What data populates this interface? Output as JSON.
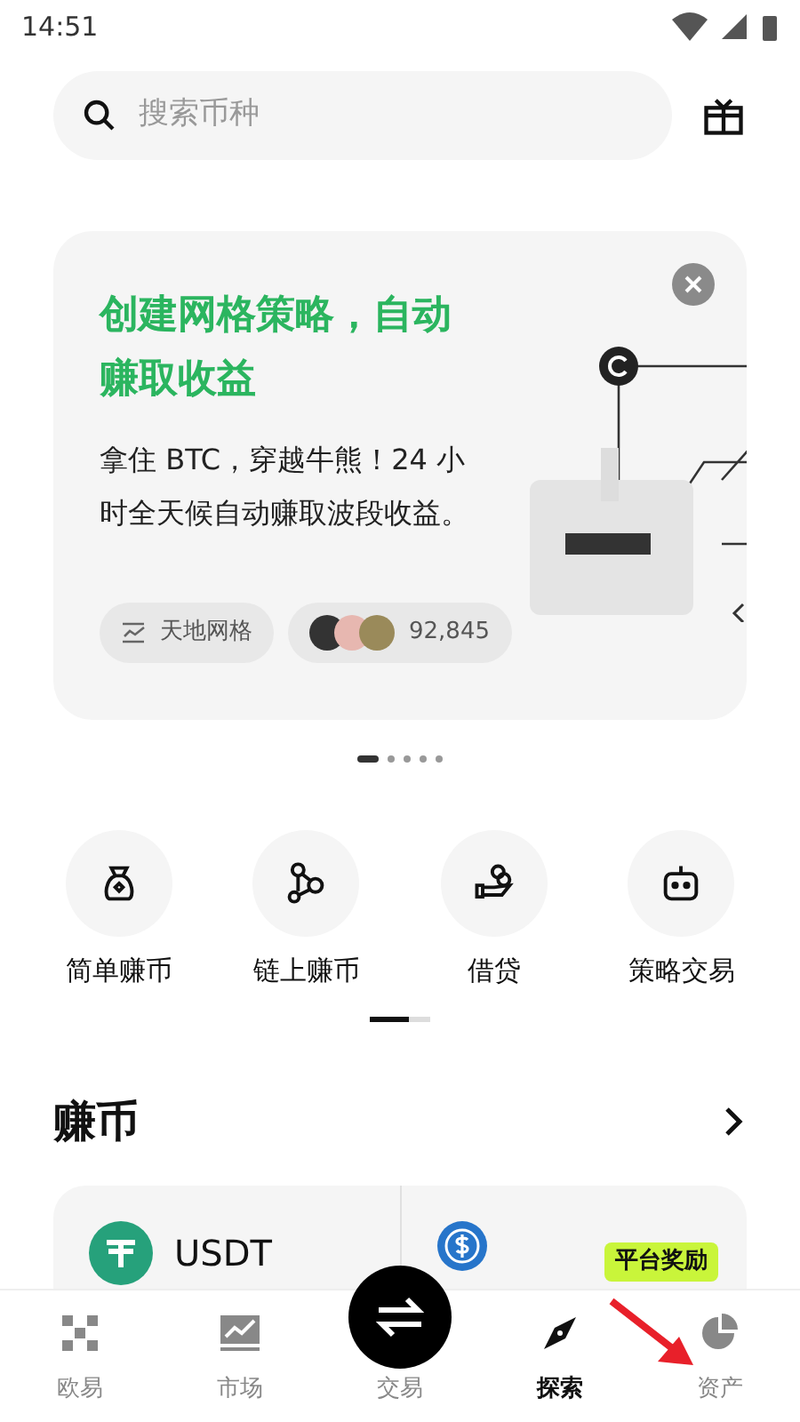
{
  "status_bar": {
    "time": "14:51"
  },
  "search": {
    "placeholder": "搜索币种"
  },
  "promo": {
    "title": "创建网格策略，自动赚取收益",
    "body": "拿住 BTC，穿越牛熊！24 小时全天候自动赚取波段收益。",
    "tag": "天地网格",
    "count": "92,845"
  },
  "carousel_dots": [
    {
      "selected": true
    },
    {
      "selected": false
    },
    {
      "selected": false
    },
    {
      "selected": false
    },
    {
      "selected": false
    }
  ],
  "shortcuts": [
    {
      "kind": "bag",
      "label": "简单赚币"
    },
    {
      "kind": "chain",
      "label": "链上赚币"
    },
    {
      "kind": "loan",
      "label": "借贷"
    },
    {
      "kind": "bot",
      "label": "策略交易"
    }
  ],
  "shortcut_pager": {
    "level": 0.65
  },
  "earn": {
    "title": "赚币",
    "items": [
      {
        "kind": "usdt",
        "name": "USDT"
      },
      {
        "kind": "usdc",
        "badge": "平台奖励"
      }
    ]
  },
  "nav": [
    {
      "kind": "grid",
      "label": "欧易",
      "selected": false
    },
    {
      "kind": "chart",
      "label": "市场",
      "selected": false
    },
    {
      "kind": "trade",
      "label": "交易",
      "selected": false
    },
    {
      "kind": "compass",
      "label": "探索",
      "selected": true
    },
    {
      "kind": "pie",
      "label": "资产",
      "selected": false
    }
  ]
}
